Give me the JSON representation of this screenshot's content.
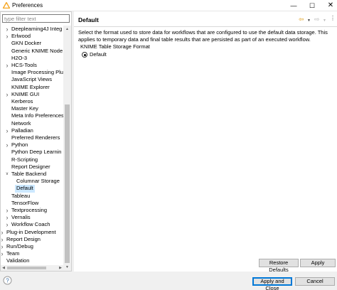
{
  "window": {
    "title": "Preferences"
  },
  "filter": {
    "placeholder": "type filter text",
    "value": ""
  },
  "tree": [
    {
      "label": "Deeplearning4J Integ",
      "level": 1,
      "arrow": "collapsed"
    },
    {
      "label": "Erlwood",
      "level": 1,
      "arrow": "collapsed"
    },
    {
      "label": "GKN Docker",
      "level": 1,
      "arrow": "none"
    },
    {
      "label": "Generic KNIME Node",
      "level": 1,
      "arrow": "none"
    },
    {
      "label": "H2O-3",
      "level": 1,
      "arrow": "none"
    },
    {
      "label": "HCS-Tools",
      "level": 1,
      "arrow": "collapsed"
    },
    {
      "label": "Image Processing Plu",
      "level": 1,
      "arrow": "none"
    },
    {
      "label": "JavaScript Views",
      "level": 1,
      "arrow": "none"
    },
    {
      "label": "KNIME Explorer",
      "level": 1,
      "arrow": "none"
    },
    {
      "label": "KNIME GUI",
      "level": 1,
      "arrow": "collapsed"
    },
    {
      "label": "Kerberos",
      "level": 1,
      "arrow": "none"
    },
    {
      "label": "Master Key",
      "level": 1,
      "arrow": "none"
    },
    {
      "label": "Meta Info Preferences",
      "level": 1,
      "arrow": "none"
    },
    {
      "label": "Network",
      "level": 1,
      "arrow": "none"
    },
    {
      "label": "Palladian",
      "level": 1,
      "arrow": "collapsed"
    },
    {
      "label": "Preferred Renderers",
      "level": 1,
      "arrow": "none"
    },
    {
      "label": "Python",
      "level": 1,
      "arrow": "collapsed"
    },
    {
      "label": "Python Deep Learnin",
      "level": 1,
      "arrow": "none"
    },
    {
      "label": "R-Scripting",
      "level": 1,
      "arrow": "none"
    },
    {
      "label": "Report Designer",
      "level": 1,
      "arrow": "none"
    },
    {
      "label": "Table Backend",
      "level": 1,
      "arrow": "expanded"
    },
    {
      "label": "Columnar Storage",
      "level": 2,
      "arrow": "none"
    },
    {
      "label": "Default",
      "level": 2,
      "arrow": "none",
      "selected": true
    },
    {
      "label": "Tableau",
      "level": 1,
      "arrow": "none"
    },
    {
      "label": "TensorFlow",
      "level": 1,
      "arrow": "none"
    },
    {
      "label": "Textprocessing",
      "level": 1,
      "arrow": "collapsed"
    },
    {
      "label": "Vernalis",
      "level": 1,
      "arrow": "collapsed"
    },
    {
      "label": "Workflow Coach",
      "level": 1,
      "arrow": "collapsed"
    },
    {
      "label": "Plug-in Development",
      "level": 0,
      "arrow": "collapsed"
    },
    {
      "label": "Report Design",
      "level": 0,
      "arrow": "collapsed"
    },
    {
      "label": "Run/Debug",
      "level": 0,
      "arrow": "collapsed"
    },
    {
      "label": "Team",
      "level": 0,
      "arrow": "collapsed"
    },
    {
      "label": "Validation",
      "level": 0,
      "arrow": "none"
    }
  ],
  "page": {
    "title": "Default",
    "description": "Select the format used to store data for workflows that are configured to use the default data storage. This applies to temporary data and final table results that are persisted as part of an executed workflow.",
    "section_label": "KNIME Table Storage Format",
    "radio_option": "Default",
    "restore_defaults": "Restore Defaults",
    "apply": "Apply"
  },
  "footer": {
    "apply_and_close": "Apply and Close",
    "cancel": "Cancel"
  },
  "icons": {
    "app": "knime-triangle-icon",
    "help": "help-icon",
    "back": "back-arrow-icon",
    "forward": "forward-arrow-icon",
    "menu": "view-menu-icon"
  },
  "colors": {
    "app_icon": "#f5a623",
    "selection": "#cce8ff",
    "default_button_border": "#0078d7"
  }
}
